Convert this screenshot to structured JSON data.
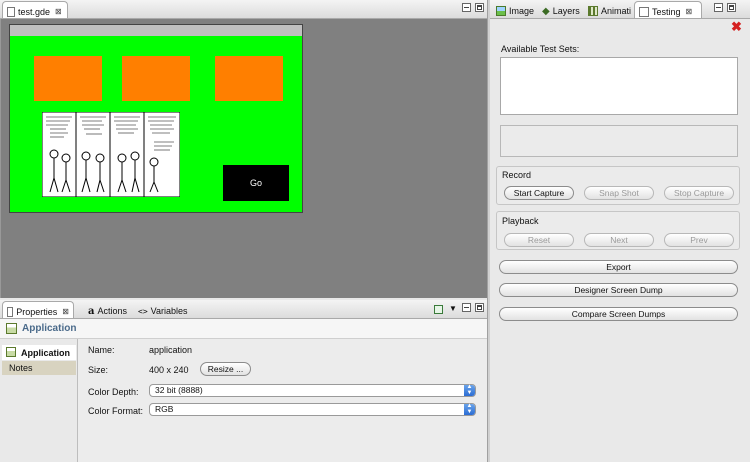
{
  "editor": {
    "tab_label": "test.gde",
    "canvas": {
      "background_color": "#808080",
      "screen_color": "#00ff00",
      "box_color": "#ff7f00",
      "go_button_label": "Go"
    }
  },
  "right_panel": {
    "tabs": [
      {
        "label": "Image",
        "icon": "image-icon"
      },
      {
        "label": "Layers",
        "icon": "layers-icon"
      },
      {
        "label": "Animati",
        "icon": "animation-icon"
      },
      {
        "label": "Testing",
        "icon": "testing-icon"
      }
    ],
    "available_test_sets_label": "Available Test Sets:",
    "record": {
      "title": "Record",
      "start_capture": "Start Capture",
      "snap_shot": "Snap Shot",
      "stop_capture": "Stop Capture"
    },
    "playback": {
      "title": "Playback",
      "reset": "Reset",
      "next": "Next",
      "prev": "Prev"
    },
    "export": "Export",
    "designer_screen_dump": "Designer Screen Dump",
    "compare_screen_dumps": "Compare Screen Dumps"
  },
  "bottom_panel": {
    "tabs": [
      {
        "label": "Properties",
        "icon": "properties-icon"
      },
      {
        "label": "Actions",
        "icon": "actions-icon"
      },
      {
        "label": "Variables",
        "icon": "variables-icon"
      }
    ],
    "header_title": "Application",
    "sidebar": [
      "Application",
      "Notes"
    ],
    "fields": {
      "name_label": "Name:",
      "name_value": "application",
      "size_label": "Size:",
      "size_value": "400 x 240",
      "resize_button": "Resize ...",
      "color_depth_label": "Color Depth:",
      "color_depth_value": "32 bit (8888)",
      "color_format_label": "Color Format:",
      "color_format_value": "RGB"
    }
  }
}
